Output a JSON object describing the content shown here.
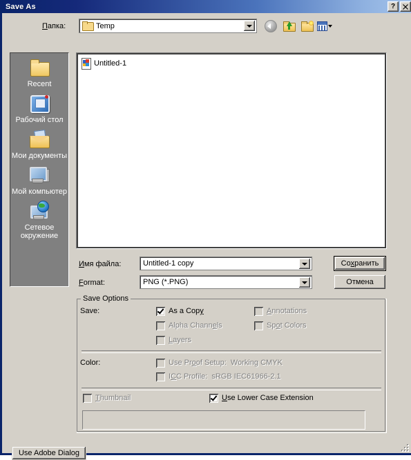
{
  "window": {
    "title": "Save As",
    "help_button": "?",
    "close_button": "✕"
  },
  "lookin": {
    "label": "Папка:",
    "label_accel": "П",
    "value": "Temp",
    "icon": "folder-icon"
  },
  "toolbar": {
    "items": [
      {
        "name": "back-button",
        "icon": "back-arrow-icon",
        "enabled": false
      },
      {
        "name": "up-one-level-button",
        "icon": "up-folder-icon",
        "enabled": true
      },
      {
        "name": "create-new-folder-button",
        "icon": "new-folder-icon",
        "enabled": true
      },
      {
        "name": "views-button",
        "icon": "views-grid-icon",
        "enabled": true
      }
    ]
  },
  "places": {
    "items": [
      {
        "label": "Recent",
        "icon": "recent-folder-icon"
      },
      {
        "label": "Рабочий стол",
        "icon": "desktop-icon"
      },
      {
        "label": "Мои документы",
        "icon": "my-documents-icon"
      },
      {
        "label": "Мой компьютер",
        "icon": "my-computer-icon"
      },
      {
        "label": "Сетевое окружение",
        "icon": "network-places-icon"
      }
    ]
  },
  "filelist": {
    "files": [
      {
        "name": "Untitled-1",
        "icon": "psd-document-icon"
      }
    ]
  },
  "filename": {
    "label": "Имя файла:",
    "label_accel": "И",
    "value": "Untitled-1 copy"
  },
  "format": {
    "label": "Format:",
    "label_accel": "F",
    "value": "PNG (*.PNG)"
  },
  "buttons": {
    "save": "Сохранить",
    "save_accel": "х",
    "cancel": "Отмена",
    "use_adobe_dialog": "Use Adobe Dialog"
  },
  "save_options": {
    "group_title": "Save Options",
    "save_label": "Save:",
    "color_label": "Color:",
    "checkboxes": [
      {
        "name": "as-a-copy",
        "label": "As a Copy",
        "checked": true,
        "enabled": true,
        "accel": "y"
      },
      {
        "name": "alpha-channels",
        "label": "Alpha Channels",
        "checked": false,
        "enabled": false,
        "accel": "l"
      },
      {
        "name": "layers",
        "label": "Layers",
        "checked": false,
        "enabled": false,
        "accel": "L"
      },
      {
        "name": "annotations",
        "label": "Annotations",
        "checked": false,
        "enabled": false,
        "accel": "A"
      },
      {
        "name": "spot-colors",
        "label": "Spot Colors",
        "checked": false,
        "enabled": false,
        "accel": "o"
      },
      {
        "name": "use-proof-setup",
        "label": "Use Proof Setup:  Working CMYK",
        "checked": false,
        "enabled": false,
        "accel": "o"
      },
      {
        "name": "icc-profile",
        "label": "ICC Profile:  sRGB IEC61966-2.1",
        "checked": false,
        "enabled": false,
        "accel": "C"
      },
      {
        "name": "thumbnail",
        "label": "Thumbnail",
        "checked": false,
        "enabled": false,
        "accel": "T"
      },
      {
        "name": "use-lower-case-extension",
        "label": "Use Lower Case Extension",
        "checked": true,
        "enabled": true,
        "accel": "U"
      }
    ]
  },
  "colors": {
    "titlebar_start": "#0a246a",
    "titlebar_end": "#a6c5ec",
    "dialog_face": "#d4d0c8",
    "places_bar": "#808080",
    "list_background": "#ffffff",
    "disabled_text": "#808080"
  }
}
